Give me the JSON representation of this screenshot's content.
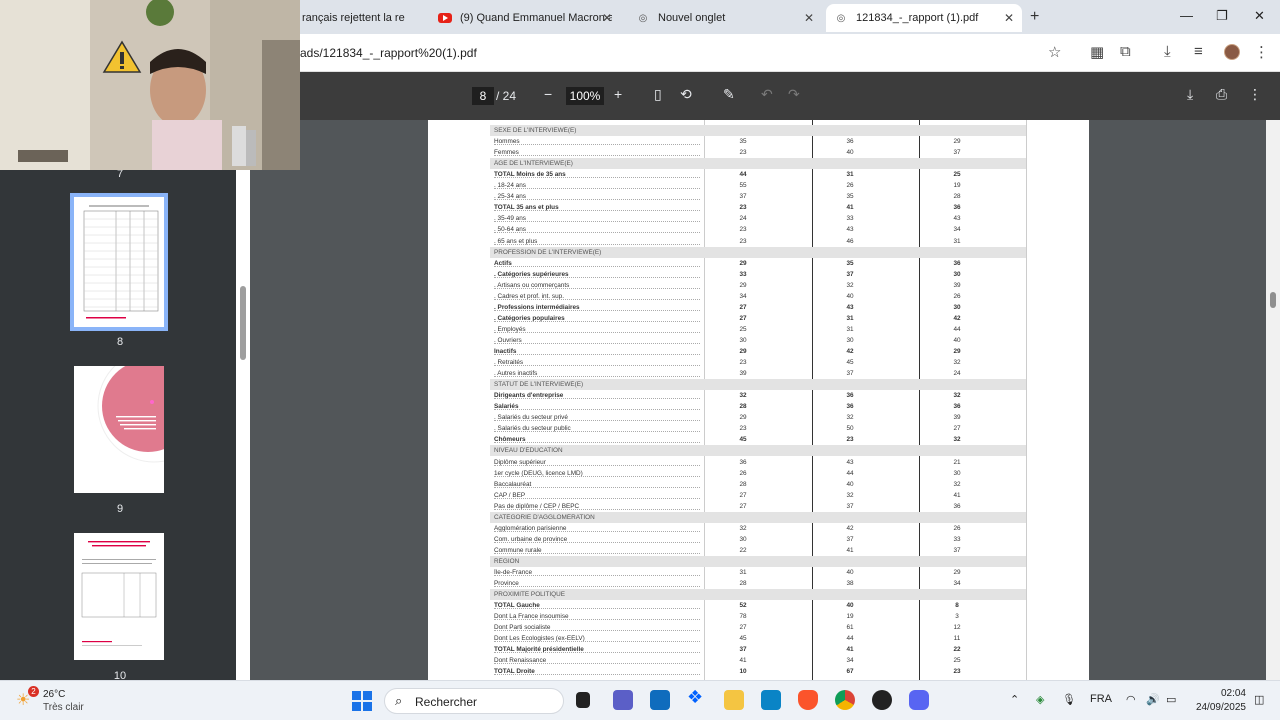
{
  "browser": {
    "tabs": [
      {
        "title": "rançais rejettent la re",
        "active": false
      },
      {
        "title": "(9) Quand Emmanuel Macron a",
        "active": false
      },
      {
        "title": "Nouvel onglet",
        "active": false
      },
      {
        "title": "121834_-_rapport (1).pdf",
        "active": true
      }
    ],
    "new_tab": "+",
    "url": "ads/121834_-_rapport%20(1).pdf"
  },
  "pdf_toolbar": {
    "current_page": "8",
    "total_pages": "/ 24",
    "zoom": "100%"
  },
  "sidebar": {
    "thumbnail_numbers": [
      "7",
      "8",
      "9",
      "10"
    ],
    "page9_text": "Le regard des Français sur le contrôle..."
  },
  "table": {
    "rows": [
      {
        "label": "SEXE DE L'INTERVIEWÉ(E)",
        "section": true
      },
      {
        "label": "Hommes",
        "v": [
          "35",
          "36",
          "29"
        ]
      },
      {
        "label": "Femmes",
        "v": [
          "23",
          "40",
          "37"
        ]
      },
      {
        "label": "ÂGE DE L'INTERVIEWÉ(E)",
        "section": true
      },
      {
        "label": "TOTAL Moins de 35 ans",
        "bold": true,
        "v": [
          "44",
          "31",
          "25"
        ]
      },
      {
        "label": ". 18-24 ans",
        "v": [
          "55",
          "26",
          "19"
        ]
      },
      {
        "label": ". 25-34 ans",
        "v": [
          "37",
          "35",
          "28"
        ]
      },
      {
        "label": "TOTAL 35 ans et plus",
        "bold": true,
        "v": [
          "23",
          "41",
          "36"
        ]
      },
      {
        "label": ". 35-49 ans",
        "v": [
          "24",
          "33",
          "43"
        ]
      },
      {
        "label": ". 50-64 ans",
        "v": [
          "23",
          "43",
          "34"
        ]
      },
      {
        "label": ". 65 ans et plus",
        "v": [
          "23",
          "46",
          "31"
        ]
      },
      {
        "label": "PROFESSION DE L'INTERVIEWÉ(E)",
        "section": true
      },
      {
        "label": "Actifs",
        "bold": true,
        "v": [
          "29",
          "35",
          "36"
        ]
      },
      {
        "label": ". Catégories supérieures",
        "bold": true,
        "v": [
          "33",
          "37",
          "30"
        ]
      },
      {
        "label": ". Artisans ou commerçants",
        "v": [
          "29",
          "32",
          "39"
        ]
      },
      {
        "label": ". Cadres et prof. int. sup.",
        "v": [
          "34",
          "40",
          "26"
        ]
      },
      {
        "label": ". Professions intermédiaires",
        "bold": true,
        "v": [
          "27",
          "43",
          "30"
        ]
      },
      {
        "label": ". Catégories populaires",
        "bold": true,
        "v": [
          "27",
          "31",
          "42"
        ]
      },
      {
        "label": ". Employés",
        "v": [
          "25",
          "31",
          "44"
        ]
      },
      {
        "label": ". Ouvriers",
        "v": [
          "30",
          "30",
          "40"
        ]
      },
      {
        "label": "Inactifs",
        "bold": true,
        "v": [
          "29",
          "42",
          "29"
        ]
      },
      {
        "label": ". Retraités",
        "v": [
          "23",
          "45",
          "32"
        ]
      },
      {
        "label": ". Autres inactifs",
        "v": [
          "39",
          "37",
          "24"
        ]
      },
      {
        "label": "STATUT DE L'INTERVIEWÉ(E)",
        "section": true
      },
      {
        "label": "Dirigeants d'entreprise",
        "bold": true,
        "v": [
          "32",
          "36",
          "32"
        ]
      },
      {
        "label": "Salariés",
        "bold": true,
        "v": [
          "28",
          "36",
          "36"
        ]
      },
      {
        "label": ". Salariés du secteur privé",
        "v": [
          "29",
          "32",
          "39"
        ]
      },
      {
        "label": ". Salariés du secteur public",
        "v": [
          "23",
          "50",
          "27"
        ]
      },
      {
        "label": "Chômeurs",
        "bold": true,
        "v": [
          "45",
          "23",
          "32"
        ]
      },
      {
        "label": "NIVEAU D'ÉDUCATION",
        "section": true
      },
      {
        "label": "Diplôme supérieur",
        "v": [
          "36",
          "43",
          "21"
        ]
      },
      {
        "label": "1er cycle (DEUG, licence LMD)",
        "v": [
          "26",
          "44",
          "30"
        ]
      },
      {
        "label": "Baccalauréat",
        "v": [
          "28",
          "40",
          "32"
        ]
      },
      {
        "label": "CAP / BEP",
        "v": [
          "27",
          "32",
          "41"
        ]
      },
      {
        "label": "Pas de diplôme / CEP / BEPC",
        "v": [
          "27",
          "37",
          "36"
        ]
      },
      {
        "label": "CATÉGORIE D'AGGLOMÉRATION",
        "section": true
      },
      {
        "label": "Agglomération parisienne",
        "v": [
          "32",
          "42",
          "26"
        ]
      },
      {
        "label": "Com. urbaine de province",
        "v": [
          "30",
          "37",
          "33"
        ]
      },
      {
        "label": "Commune rurale",
        "v": [
          "22",
          "41",
          "37"
        ]
      },
      {
        "label": "RÉGION",
        "section": true
      },
      {
        "label": "Île-de-France",
        "v": [
          "31",
          "40",
          "29"
        ]
      },
      {
        "label": "Province",
        "v": [
          "28",
          "38",
          "34"
        ]
      },
      {
        "label": "PROXIMITÉ POLITIQUE",
        "section": true
      },
      {
        "label": "TOTAL Gauche",
        "bold": true,
        "v": [
          "52",
          "40",
          "8"
        ]
      },
      {
        "label": "Dont La France insoumise",
        "v": [
          "78",
          "19",
          "3"
        ]
      },
      {
        "label": "Dont Parti socialiste",
        "v": [
          "27",
          "61",
          "12"
        ]
      },
      {
        "label": "Dont Les Écologistes (ex-EÉLV)",
        "v": [
          "45",
          "44",
          "11"
        ]
      },
      {
        "label": "TOTAL Majorité présidentielle",
        "bold": true,
        "v": [
          "37",
          "41",
          "22"
        ]
      },
      {
        "label": "Dont Renaissance",
        "v": [
          "41",
          "34",
          "25"
        ]
      },
      {
        "label": "TOTAL Droite",
        "bold": true,
        "v": [
          "10",
          "67",
          "23"
        ]
      }
    ]
  },
  "taskbar": {
    "weather_temp": "26°C",
    "weather_desc": "Très clair",
    "weather_badge": "2",
    "search_label": "Rechercher",
    "lang": "FRA",
    "time": "02:04",
    "date": "24/09/2025"
  },
  "colors": {
    "pdf_toolbar_bg": "#3c3c3c",
    "viewer_bg": "#525659",
    "sidebar_bg": "#323639",
    "thumb_selected": "#8ab4f8",
    "pink_accent": "#e07a8e"
  }
}
